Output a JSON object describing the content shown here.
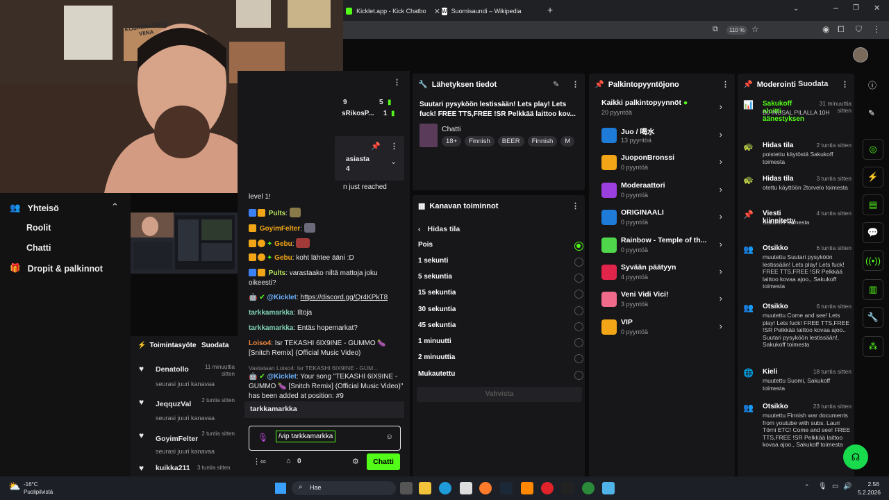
{
  "browser": {
    "tabs": [
      {
        "label": "Kicklet.app - Kick Chatbot and C"
      },
      {
        "label": "Suomisaundi – Wikipedia"
      }
    ],
    "zoom": "110 %"
  },
  "webcam": {
    "poster_text": "KOSKENKORVA VIINA"
  },
  "leftnav": {
    "community": "Yhteisö",
    "items": [
      "Roolit",
      "Chatti",
      "Dropit & palkinnot"
    ]
  },
  "activity": {
    "title": "Toimintasyöte",
    "follow": "Suodata",
    "rows": [
      {
        "name": "Denatollo",
        "time": "11 minuuttia sitten",
        "desc": "seurasi juuri kanavaa"
      },
      {
        "name": "JeqquzVal",
        "time": "2 tuntia sitten",
        "desc": "seurasi juuri kanavaa"
      },
      {
        "name": "GoyimFelter",
        "time": "2 tuntia sitten",
        "desc": "seurasi juuri kanavaa"
      },
      {
        "name": "kuikka211",
        "time": "3 tuntia sitten",
        "desc": ""
      }
    ]
  },
  "chat": {
    "top_partial": {
      "c1": "9",
      "c2": "5",
      "r1": "sRikosP...",
      "r2": "1"
    },
    "pinned_partial": [
      "asiasta",
      "4"
    ],
    "reached": "n just reached",
    "level": "level 1!",
    "messages": [
      {
        "user": "Pults",
        "sep": ":",
        "text": ""
      },
      {
        "user": "GoyimFelter",
        "sep": ":",
        "text": ""
      },
      {
        "user": "Gebu",
        "sep": ":",
        "text": ""
      },
      {
        "user": "Gebu",
        "sep": ":",
        "text": " koht lähtee ääni :D"
      },
      {
        "user": "Pults",
        "sep": ":",
        "text": " varastaako niltä mattoja joku oikeesti?"
      },
      {
        "user": "@Kicklet",
        "sep": ":",
        "text": "https://discord.gg/Qr4KPkT8"
      },
      {
        "user": "tarkkamarkka",
        "sep": ":",
        "text": " Iltoja"
      },
      {
        "user": "tarkkamarkka",
        "sep": ":",
        "text": " Entäs hopemarkat?"
      },
      {
        "user": "Loiso4",
        "sep": ":",
        "text": " Isr TEKASHI 6IX9INE - GUMMO 🍆 [Snitch Remix] (Official Music Video)"
      },
      {
        "user": "@Kicklet",
        "sep": ":",
        "text": " Your song \"TEKASHI 6IX9INE - GUMMO 🍆 [Snitch Remix] (Official Music Video)\" has been added at position: #9"
      }
    ],
    "reply": "Vastataan Loiso4: Isr TEKASHI 6IX9INE - GUM...",
    "suggestion": "tarkkamarkka",
    "input_value": "/vip tarkkamarkka",
    "points": "0",
    "send": "Chatti"
  },
  "broadcast": {
    "title": "Lähetyksen tiedot",
    "stream_title": "Suutari pysyköön lestissään! Lets play! Lets fuck! FREE TTS,FREE !SR Pelkkää laittoo kov...",
    "category": "Chatti",
    "tags": [
      "18+",
      "Finnish",
      "BEER",
      "Finnish",
      "M"
    ]
  },
  "actions": {
    "title": "Kanavan toiminnot",
    "back": "Hidas tila",
    "options": [
      "Pois",
      "1 sekunti",
      "5 sekuntia",
      "15 sekuntia",
      "30 sekuntia",
      "45 sekuntia",
      "1 minuutti",
      "2 minuuttia",
      "Mukautettu"
    ],
    "selected": "Pois",
    "confirm": "Vahvista"
  },
  "rewards": {
    "title": "Palkintopyyntöjono",
    "all": "Kaikki palkintopyynnöt",
    "all_count": "20 pyyntöä",
    "items": [
      {
        "name": "Juo / 喝水",
        "count": "13 pyyntöä",
        "color": "#1e7bd8"
      },
      {
        "name": "JuoponBronssi",
        "count": "0 pyyntöä",
        "color": "#f2a516"
      },
      {
        "name": "Moderaattori",
        "count": "0 pyyntöä",
        "color": "#9b3fe0"
      },
      {
        "name": "ORIGINAALI",
        "count": "0 pyyntöä",
        "color": "#1e7bd8"
      },
      {
        "name": "Rainbow - Temple of th...",
        "count": "0 pyyntöä",
        "color": "#4fd64a"
      },
      {
        "name": "Syvään päätyyn",
        "count": "4 pyyntöä",
        "color": "#e0244a"
      },
      {
        "name": "Veni Vidi Vici!",
        "count": "3 pyyntöä",
        "color": "#f06a8c"
      },
      {
        "name": "VIP",
        "count": "0 pyyntöä",
        "color": "#f2a516"
      }
    ]
  },
  "moderation": {
    "title": "Moderointi",
    "filter": "Suodata",
    "events": [
      {
        "icon": "📊",
        "title": "Sakukoff aloitti äänestyksen",
        "time": "31 minuuttia sitten",
        "desc": "DJ INUSAL PILALLA 10H"
      },
      {
        "icon": "🐢",
        "title": "Hidas tila",
        "time": "2 tuntia sitten",
        "desc": "poistettu käytöstä Sakukoff toimesta"
      },
      {
        "icon": "🐢",
        "title": "Hidas tila",
        "time": "3 tuntia sitten",
        "desc": "otettu käyttöön 2torvelo toimesta"
      },
      {
        "icon": "📌",
        "title": "Viesti kiinnitetty",
        "time": "4 tuntia sitten",
        "desc": "Sakukoff toimesta"
      },
      {
        "icon": "👥",
        "title": "Otsikko",
        "time": "6 tuntia sitten",
        "desc": "muutettu Suutari pysyköön lestissään! Lets play! Lets fuck! FREE TTS,FREE !SR Pelkkää laittoo kovaa ajoo., Sakukoff toimesta"
      },
      {
        "icon": "👥",
        "title": "Otsikko",
        "time": "6 tuntia sitten",
        "desc": "muutettu Come and see! Lets play! Lets fuck! FREE TTS,FREE !SR Pelkkää laittoo kovaa ajoo.. Suutari pysyköön lestissään!, Sakukoff toimesta"
      },
      {
        "icon": "🌐",
        "title": "Kieli",
        "time": "18 tuntia sitten",
        "desc": "muutettu Suomi, Sakukoff toimesta"
      },
      {
        "icon": "👥",
        "title": "Otsikko",
        "time": "23 tuntia sitten",
        "desc": "muutettu Finnish war documents from youtube with subs. Lauri Törni ETC! Come and see! FREE TTS,FREE !SR Pelkkää laittoo kovaa ajoo., Sakukoff toimesta"
      }
    ]
  },
  "taskbar": {
    "temp": "-16°C",
    "weather": "Puolipilvistä",
    "search": "Hae",
    "time": "2.56",
    "date": "5.2.2026"
  }
}
